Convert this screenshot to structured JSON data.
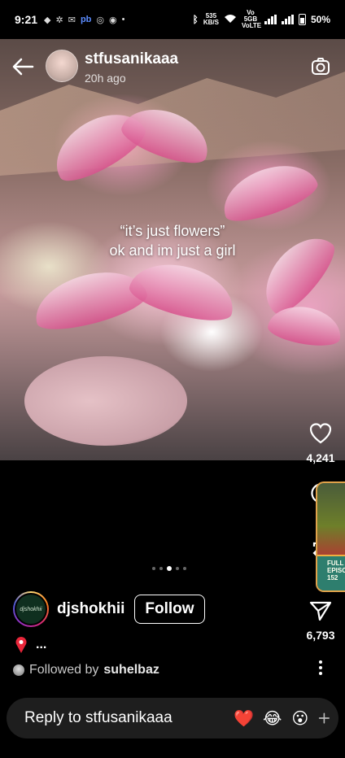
{
  "status_bar": {
    "time": "9:21",
    "left_icons": [
      "notification-icon",
      "gear-icon",
      "mail-icon",
      "pb",
      "sync-icon",
      "circle-icon",
      "dot"
    ],
    "net_speed_value": "535",
    "net_speed_unit": "KB/S",
    "volte": "Vo 5GB VoLTE",
    "battery": "50%"
  },
  "story": {
    "username": "stfusanikaaa",
    "time_ago": "20h ago",
    "caption_line1": "“it’s just flowers”",
    "caption_line2": "ok and im just a girl"
  },
  "rail": {
    "likes": "4,241",
    "shares": "6,793"
  },
  "widget": {
    "badge_text": "FULL EPISOD 152"
  },
  "author": {
    "avatar_text": "djshokhii",
    "name": "djshokhii",
    "follow_label": "Follow"
  },
  "location": {
    "text": "..."
  },
  "followed": {
    "prefix": "Followed by",
    "name": "suhelbaz"
  },
  "reply": {
    "placeholder": "Reply to stfusanikaaa",
    "emojis": [
      "❤️",
      "😂",
      "😮"
    ]
  },
  "colors": {
    "background": "#000000",
    "reply_bar": "#1e1e1e",
    "accent_pink": "#e0508c"
  }
}
